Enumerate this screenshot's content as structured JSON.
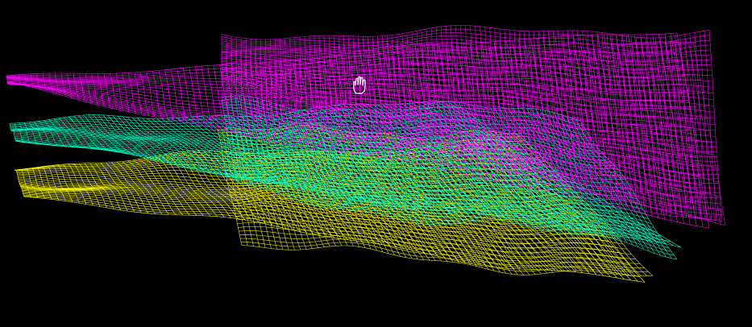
{
  "scene": {
    "background": "#000000",
    "surfaces": [
      {
        "name": "magenta-horizon-surface",
        "color": "#ff00ff",
        "order": 1
      },
      {
        "name": "cyan-horizon-surface",
        "color": "#00ffc8",
        "order": 2
      },
      {
        "name": "yellow-horizon-surface",
        "color": "#ffff00",
        "order": 3
      }
    ]
  },
  "cursor": {
    "icon": "hand-pan-icon",
    "color": "#ffffff"
  }
}
